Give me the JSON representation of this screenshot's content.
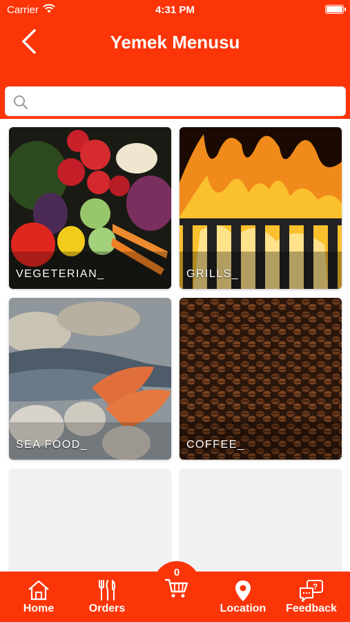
{
  "status_bar": {
    "carrier": "Carrier",
    "time": "4:31 PM"
  },
  "header": {
    "title": "Yemek Menusu"
  },
  "search": {
    "placeholder": "",
    "value": ""
  },
  "categories": [
    {
      "label": "VEGETERIAN_"
    },
    {
      "label": "GRILLS_"
    },
    {
      "label": "SEA FOOD_"
    },
    {
      "label": "COFFEE_"
    }
  ],
  "cart": {
    "count": "0"
  },
  "tabs": [
    {
      "label": "Home",
      "icon": "home-icon"
    },
    {
      "label": "Orders",
      "icon": "cutlery-icon"
    },
    {
      "label": "Location",
      "icon": "location-pin-icon"
    },
    {
      "label": "Feedback",
      "icon": "feedback-chat-icon"
    }
  ],
  "colors": {
    "primary": "#fc3508",
    "card_placeholder": "#f1f1f1"
  }
}
